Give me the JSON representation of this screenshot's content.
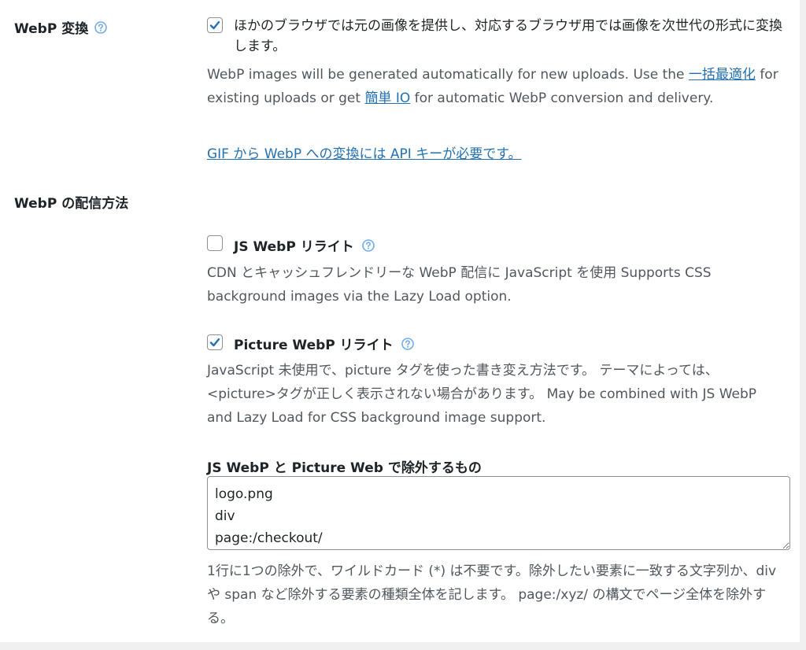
{
  "webp_conversion": {
    "label": "WebP 変換",
    "checked": true,
    "checkbox_text": "ほかのブラウザでは元の画像を提供し、対応するブラウザ用では画像を次世代の形式に変換します。",
    "desc_part1": "WebP images will be generated automatically for new uploads. Use the ",
    "link_bulk": "一括最適化",
    "desc_part2": " for existing uploads or get ",
    "link_easyio": "簡単 IO",
    "desc_part3": " for automatic WebP conversion and delivery.",
    "gif_link": "GIF から WebP への変換には API キーが必要です。"
  },
  "delivery": {
    "label": "WebP の配信方法",
    "js_webp": {
      "label": "JS WebP リライト",
      "checked": false,
      "desc": "CDN とキャッシュフレンドリーな WebP 配信に JavaScript を使用 Supports CSS background images via the Lazy Load option."
    },
    "picture_webp": {
      "label": "Picture WebP リライト",
      "checked": true,
      "desc": "JavaScript 未使用で、picture タグを使った書き変え方法です。 テーマによっては、<picture>タグが正しく表示されない場合があります。 May be combined with JS WebP and Lazy Load for CSS background image support."
    },
    "exclusions": {
      "label": "JS WebP と Picture Web で除外するもの",
      "value": "logo.png\ndiv\npage:/checkout/",
      "desc": "1行に1つの除外で、ワイルドカード (*) は不要です。除外したい要素に一致する文字列か、div や span など除外する要素の種類全体を記します。 page:/xyz/ の構文でページ全体を除外する。"
    }
  },
  "icons": {
    "help": "question-circle-icon",
    "check": "checkmark-icon"
  },
  "colors": {
    "accent": "#2271b1",
    "help": "#72aee6",
    "text": "#1d2327",
    "muted": "#50575e",
    "background": "#f0f0f1"
  }
}
